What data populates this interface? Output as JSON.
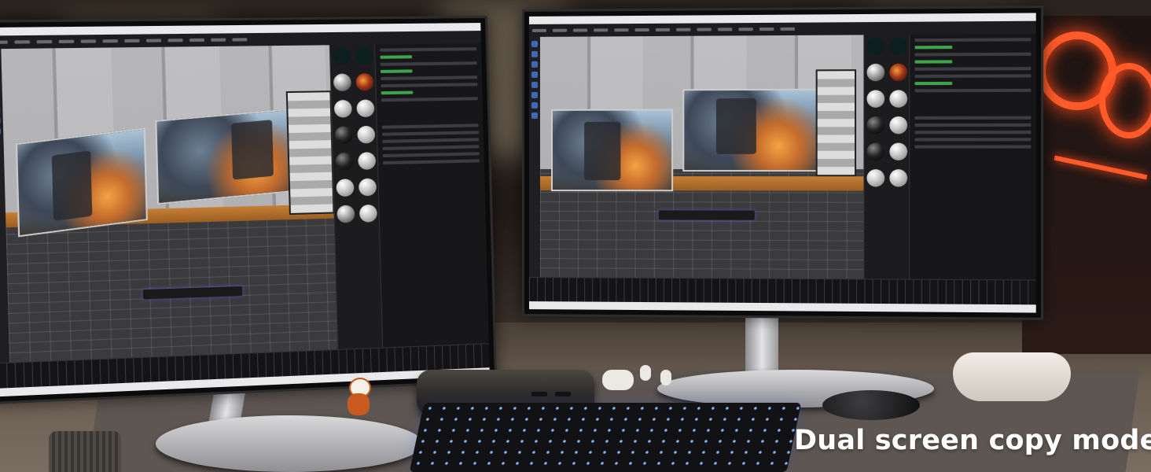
{
  "photo": {
    "caption": "Dual screen copy mode",
    "caption_color": "#ffffff",
    "screens": {
      "left_monitor": {
        "app_content": "3d-modeling-software-viewport"
      },
      "right_monitor": {
        "app_content": "3d-modeling-software-viewport"
      }
    },
    "accent_colors": {
      "case_fan_glow": "#ff5a2a",
      "viewport_desk_wood": "#c67f35",
      "keyboard_backlight": "#8ab4ff"
    }
  }
}
